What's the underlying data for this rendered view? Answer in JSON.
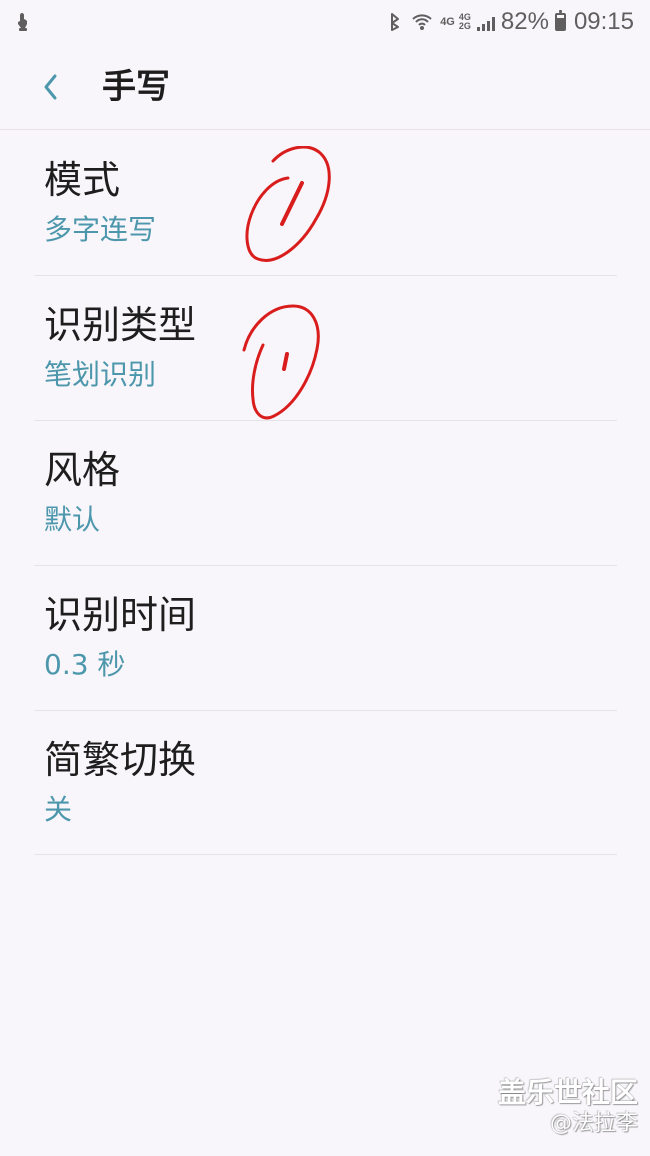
{
  "status_bar": {
    "network_top": "4G",
    "network_mid_top": "4G",
    "network_mid_bottom": "2G",
    "battery_percent": "82%",
    "time": "09:15",
    "battery_level": 0.82,
    "icons": {
      "left": "gesture-icon",
      "bluetooth": "bluetooth-icon",
      "wifi": "wifi-icon",
      "signal": "signal-icon",
      "battery": "battery-icon"
    }
  },
  "header": {
    "title": "手写",
    "back_icon": "chevron-left-icon",
    "accent_color": "#4d97ac"
  },
  "settings": [
    {
      "title": "模式",
      "value": "多字连写"
    },
    {
      "title": "识别类型",
      "value": "笔划识别"
    },
    {
      "title": "风格",
      "value": "默认"
    },
    {
      "title": "识别时间",
      "value": "0.3 秒"
    },
    {
      "title": "简繁切换",
      "value": "关"
    }
  ],
  "watermark": {
    "line1": "盖乐世社区",
    "line2": "@法拉李"
  },
  "colors": {
    "background": "#f8f6fa",
    "title_text": "#1e1e1e",
    "value_text": "#4d97ac",
    "annotation": "#d91d1d"
  }
}
